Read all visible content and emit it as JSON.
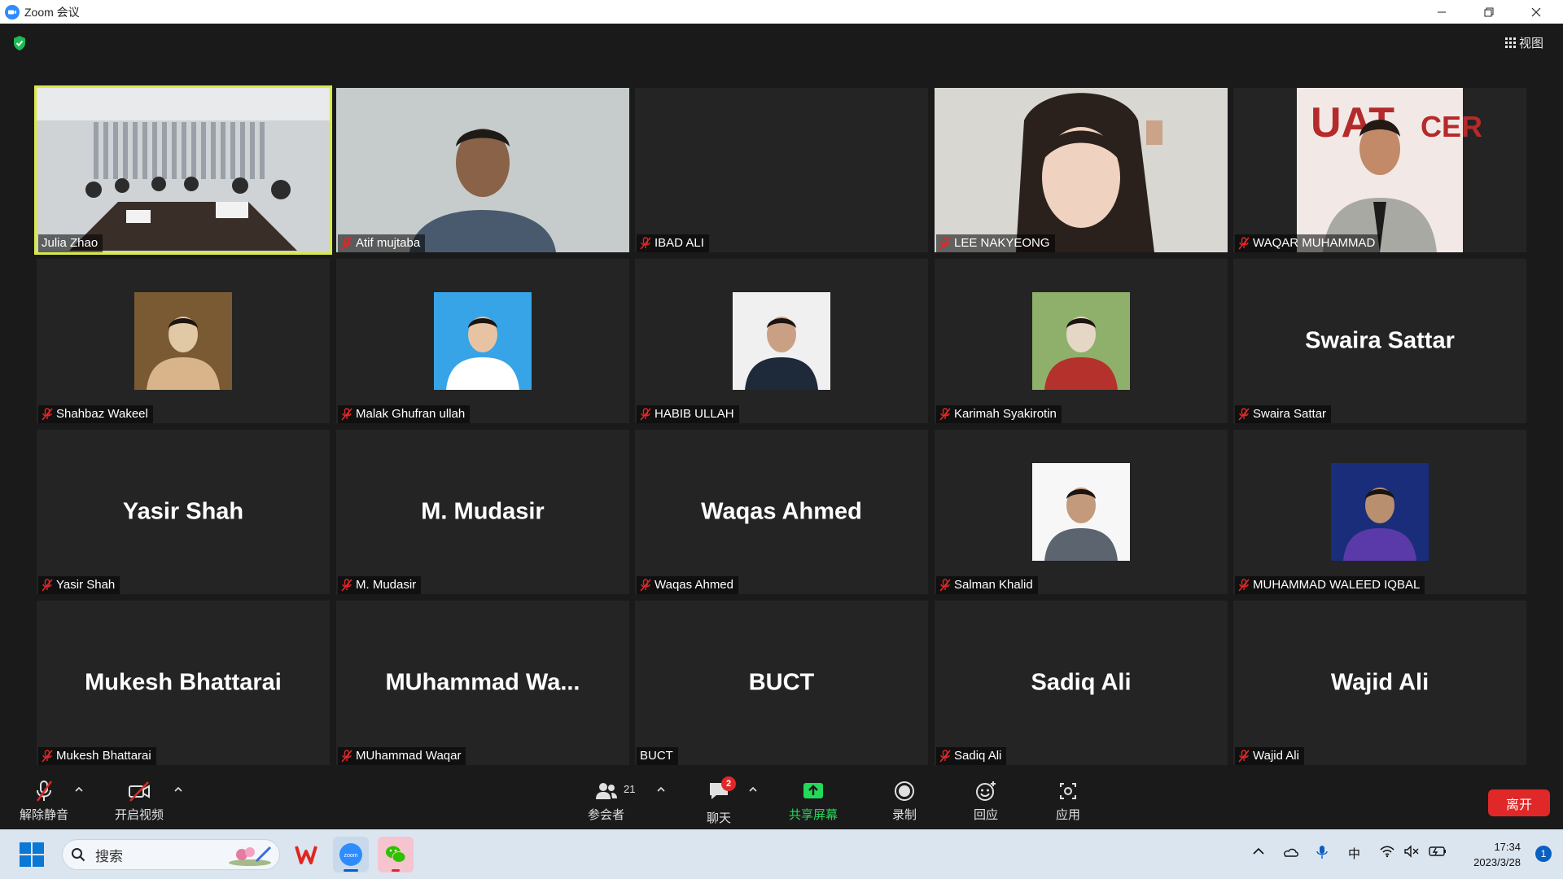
{
  "window": {
    "title": "Zoom 会议"
  },
  "meeting": {
    "view_label": "视图",
    "tiles": [
      {
        "label": "Julia Zhao",
        "big": "",
        "muted": false,
        "kind": "video-room"
      },
      {
        "label": "Atif mujtaba",
        "big": "",
        "muted": true,
        "kind": "video-man"
      },
      {
        "label": "IBAD ALI",
        "big": "",
        "muted": true,
        "kind": "blank"
      },
      {
        "label": "LEE NAKYEONG",
        "big": "",
        "muted": true,
        "kind": "video-woman"
      },
      {
        "label": "WAQAR MUHAMMAD",
        "big": "",
        "muted": true,
        "kind": "video-suit"
      },
      {
        "label": "Shahbaz Wakeel",
        "big": "",
        "muted": true,
        "kind": "avatar-1"
      },
      {
        "label": "Malak Ghufran ullah",
        "big": "",
        "muted": true,
        "kind": "avatar-2"
      },
      {
        "label": "HABIB ULLAH",
        "big": "",
        "muted": true,
        "kind": "avatar-3"
      },
      {
        "label": "Karimah Syakirotin",
        "big": "",
        "muted": true,
        "kind": "avatar-4"
      },
      {
        "label": "Swaira Sattar",
        "big": "Swaira Sattar",
        "muted": true,
        "kind": "name"
      },
      {
        "label": "Yasir Shah",
        "big": "Yasir Shah",
        "muted": true,
        "kind": "name"
      },
      {
        "label": "M. Mudasir",
        "big": "M. Mudasir",
        "muted": true,
        "kind": "name"
      },
      {
        "label": "Waqas Ahmed",
        "big": "Waqas Ahmed",
        "muted": true,
        "kind": "name"
      },
      {
        "label": "Salman Khalid",
        "big": "",
        "muted": true,
        "kind": "avatar-5"
      },
      {
        "label": "MUHAMMAD WALEED IQBAL",
        "big": "",
        "muted": true,
        "kind": "avatar-6"
      },
      {
        "label": "Mukesh Bhattarai",
        "big": "Mukesh Bhattarai",
        "muted": true,
        "kind": "name"
      },
      {
        "label": "MUhammad Waqar",
        "big": "MUhammad  Wa...",
        "muted": true,
        "kind": "name"
      },
      {
        "label": "BUCT",
        "big": "BUCT",
        "muted": false,
        "kind": "name"
      },
      {
        "label": "Sadiq Ali",
        "big": "Sadiq Ali",
        "muted": true,
        "kind": "name"
      },
      {
        "label": "Wajid Ali",
        "big": "Wajid Ali",
        "muted": true,
        "kind": "name"
      }
    ]
  },
  "toolbar": {
    "unmute": "解除静音",
    "start_video": "开启视频",
    "participants": "参会者",
    "participants_count": "21",
    "chat": "聊天",
    "chat_badge": "2",
    "share": "共享屏幕",
    "record": "录制",
    "reactions": "回应",
    "apps": "应用",
    "leave": "离开"
  },
  "taskbar": {
    "search_placeholder": "搜索",
    "ime": "中",
    "time": "17:34",
    "date": "2023/3/28",
    "notifications": "1"
  },
  "colors": {
    "share_green": "#23d959",
    "active_border": "#d9e94a",
    "leave_red": "#e02828",
    "zoom_blue": "#2d8cff"
  }
}
